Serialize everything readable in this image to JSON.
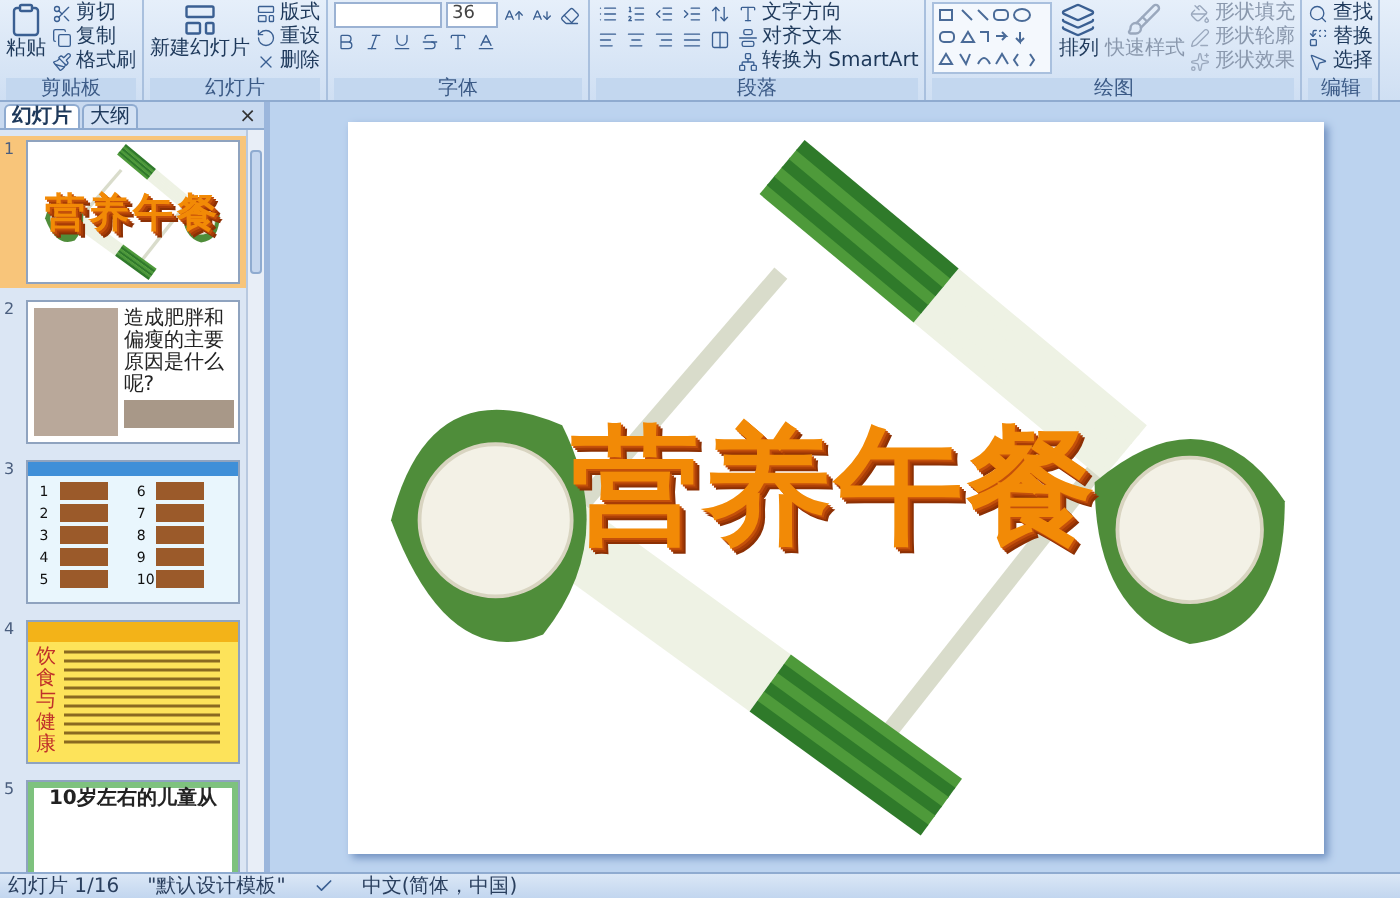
{
  "ribbon": {
    "groups": [
      {
        "kind": "clipboard",
        "label": "剪贴板",
        "items": [
          "粘贴",
          "剪切",
          "复制",
          "格式刷"
        ]
      },
      {
        "kind": "slides",
        "label": "幻灯片",
        "items": [
          "新建幻灯片",
          "版式",
          "重设",
          "删除"
        ]
      },
      {
        "kind": "font",
        "label": "字体",
        "font_size": "36"
      },
      {
        "kind": "paragraph",
        "label": "段落",
        "items": [
          "文字方向",
          "对齐文本",
          "转换为 SmartArt"
        ]
      },
      {
        "kind": "drawing",
        "label": "绘图",
        "items": [
          {
            "label": "排列",
            "disabled": false
          },
          {
            "label": "快速样式",
            "disabled": true
          }
        ],
        "shape_items": [
          {
            "label": "形状填充",
            "disabled": true
          },
          {
            "label": "形状轮廓",
            "disabled": true
          },
          {
            "label": "形状效果",
            "disabled": true
          }
        ]
      },
      {
        "kind": "editing",
        "label": "编辑",
        "items": [
          "查找",
          "替换",
          "选择"
        ]
      }
    ]
  },
  "panel": {
    "tabs": [
      {
        "label": "幻灯片",
        "selected": true
      },
      {
        "label": "大纲",
        "selected": false
      }
    ],
    "close": "×",
    "slides": [
      {
        "number": "1",
        "kind": "title",
        "selected": true,
        "title": "营养午餐"
      },
      {
        "number": "2",
        "kind": "photos",
        "selected": false,
        "text": "造成肥胖和偏瘦的主要原因是什么呢?"
      },
      {
        "number": "3",
        "kind": "menu",
        "selected": false,
        "numbers": [
          "1",
          "2",
          "3",
          "4",
          "5",
          "6",
          "7",
          "8",
          "9",
          "10"
        ]
      },
      {
        "number": "4",
        "kind": "article",
        "selected": false,
        "text": "饮食与健康"
      },
      {
        "number": "5",
        "kind": "notice",
        "selected": false,
        "text": "10岁左右的儿童从"
      }
    ]
  },
  "slide": {
    "title": "营养午餐"
  },
  "status_bar": {
    "slide": "幻灯片 1/16",
    "theme": "\"默认设计模板\"",
    "language": "中文(简体，中国)"
  }
}
